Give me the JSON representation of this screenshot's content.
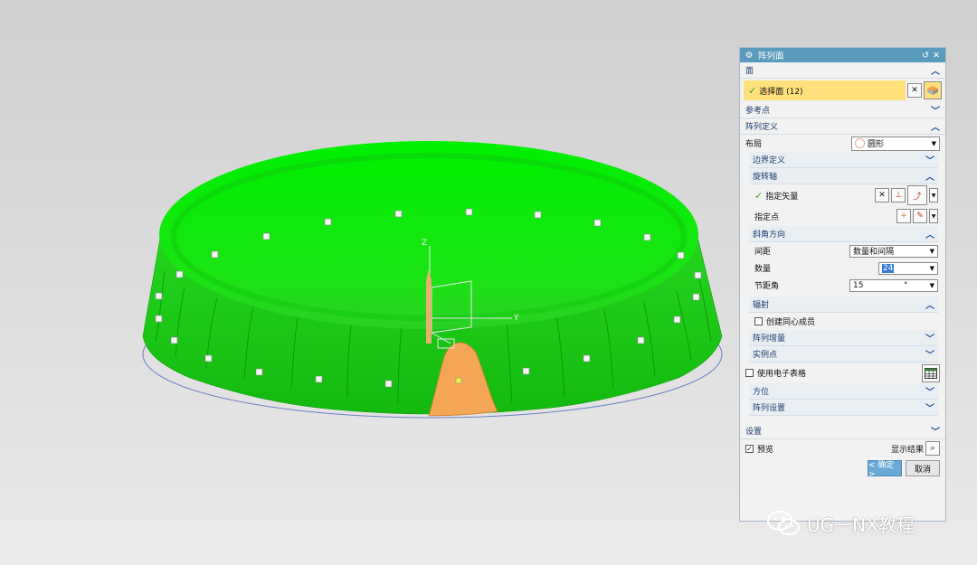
{
  "viewport": {
    "axis_labels": {
      "z": "Z",
      "y": "Y"
    },
    "colors": {
      "body": "#22e31d",
      "selected_face": "#f5a655",
      "edge_ellipse": "#6b7fc4"
    }
  },
  "dialog": {
    "title": "阵列面",
    "title_icons": [
      "gear-icon",
      "reset-icon",
      "close-icon"
    ],
    "face_section": {
      "label": "面",
      "select_face": "选择面 (12)"
    },
    "ref_point_section": {
      "label": "参考点"
    },
    "array_def": {
      "label": "阵列定义",
      "layout_label": "布局",
      "layout_value": "圆形",
      "boundary": "边界定义",
      "rotation_axis": {
        "label": "旋转轴",
        "specify_vector": "指定矢量",
        "specify_point": "指定点"
      },
      "angle_direction": {
        "label": "斜角方向",
        "spacing_label": "间距",
        "spacing_value": "数量和间隔",
        "count_label": "数量",
        "count_value": "24",
        "pitch_label": "节距角",
        "pitch_value": "15",
        "pitch_unit": "°"
      },
      "radial": {
        "label": "辐射",
        "create_concentric": "创建同心成员"
      },
      "increment": "阵列增量",
      "instance_point": "实例点",
      "use_spreadsheet": "使用电子表格",
      "orientation": "方位",
      "array_settings": "阵列设置"
    },
    "settings_section": {
      "label": "设置"
    },
    "preview_label": "预览",
    "show_result": "显示结果",
    "ok_button": "< 确定 >",
    "cancel_button": "取消"
  },
  "watermark": "UG一NX教程"
}
